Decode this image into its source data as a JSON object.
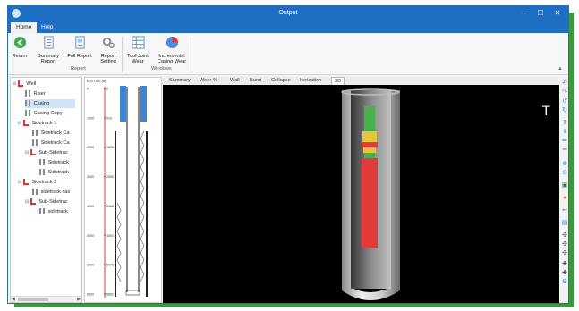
{
  "window": {
    "title": "Output"
  },
  "ribbon": {
    "tabs": [
      "Home",
      "Help"
    ],
    "buttons": {
      "return": "Return",
      "summary_report_1": "Summary",
      "summary_report_2": "Report",
      "full_report": "Full Report",
      "report_setting_1": "Report",
      "report_setting_2": "Setting",
      "tool_joint_1": "Tool Joint",
      "tool_joint_2": "Wear",
      "incremental_1": "Incremental",
      "incremental_2": "Casing Wear"
    },
    "groups": {
      "report": "Report",
      "windows": "Windows"
    }
  },
  "tree": {
    "items": [
      {
        "label": "Well"
      },
      {
        "label": "Riser"
      },
      {
        "label": "Casing"
      },
      {
        "label": "Casing Copy"
      },
      {
        "label": "Sidetrack 1"
      },
      {
        "label": "Sidetrack Ca"
      },
      {
        "label": "Sidetrack Ca"
      },
      {
        "label": "Sub-Sidetrac"
      },
      {
        "label": "Sidetrack"
      },
      {
        "label": "Sidetrack"
      },
      {
        "label": "Sidetrack 2"
      },
      {
        "label": "sidetrack cas"
      },
      {
        "label": "Sub-Sidetrac"
      },
      {
        "label": "sidetrack"
      }
    ]
  },
  "column": {
    "axis_label": "MD/TVD (ft)",
    "md_ticks": [
      "0",
      "1000",
      "2000",
      "3000",
      "4000",
      "5000",
      "6000",
      "6500"
    ],
    "tvd_ticks": [
      "0",
      "910",
      "1828",
      "2559",
      "3468",
      "4403",
      "5376",
      "5852"
    ]
  },
  "view_tabs": [
    "Summary",
    "Wear %",
    "Wall",
    "Burst",
    "Collapse",
    "Iterization",
    "3D"
  ],
  "active_view_tab": "3D",
  "axis_indicator": "T",
  "colors": {
    "titlebar": "#1e6fc4",
    "wear_red": "#e23b3b",
    "wear_green": "#46b04a",
    "wear_yellow": "#e8c43a",
    "frame_green": "#3a9a3a"
  }
}
